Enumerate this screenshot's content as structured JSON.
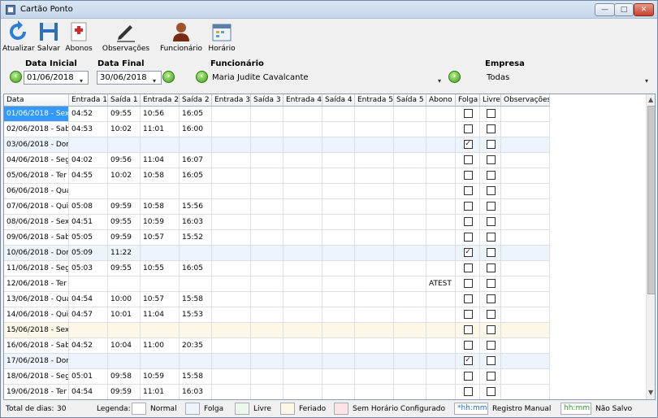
{
  "window": {
    "title": "Cartão Ponto",
    "min": "—",
    "max": "□",
    "close": "✕"
  },
  "toolbar": [
    {
      "label": "Atualizar",
      "icon": "refresh-icon"
    },
    {
      "label": "Salvar",
      "icon": "save-icon"
    },
    {
      "label": "Abonos",
      "icon": "medical-icon"
    },
    {
      "label": "Observações",
      "icon": "pen-icon"
    },
    {
      "label": "Funcionário",
      "icon": "user-icon"
    },
    {
      "label": "Horário",
      "icon": "calendar-icon"
    }
  ],
  "filters": {
    "data_inicial_label": "Data Inicial",
    "data_inicial": "01/06/2018",
    "data_final_label": "Data Final",
    "data_final": "30/06/2018",
    "funcionario_label": "Funcionário",
    "funcionario": "Maria Judite Cavalcante",
    "empresa_label": "Empresa",
    "empresa": "Todas"
  },
  "table": {
    "columns": [
      "Data",
      "Entrada 1",
      "Saída 1",
      "Entrada 2",
      "Saída 2",
      "Entrada 3",
      "Saída 3",
      "Entrada 4",
      "Saída 4",
      "Entrada 5",
      "Saída 5",
      "Abono",
      "Folga",
      "Livre",
      "Observações"
    ],
    "rows": [
      {
        "data": "01/06/2018 - Sex",
        "e1": "04:52",
        "s1": "09:55",
        "e2": "10:56",
        "s2": "16:05",
        "abono": "",
        "folga": false,
        "livre": false,
        "kind": "sel"
      },
      {
        "data": "02/06/2018 - Sab",
        "e1": "04:53",
        "s1": "10:02",
        "e2": "11:01",
        "s2": "16:00",
        "abono": "",
        "folga": false,
        "livre": false,
        "kind": "normal"
      },
      {
        "data": "03/06/2018 - Dom",
        "e1": "",
        "s1": "",
        "e2": "",
        "s2": "",
        "abono": "",
        "folga": true,
        "livre": false,
        "kind": "folga"
      },
      {
        "data": "04/06/2018 - Seg",
        "e1": "04:02",
        "s1": "09:56",
        "e2": "11:04",
        "s2": "16:07",
        "abono": "",
        "folga": false,
        "livre": false,
        "kind": "normal"
      },
      {
        "data": "05/06/2018 - Ter",
        "e1": "04:55",
        "s1": "10:02",
        "e2": "10:58",
        "s2": "16:05",
        "abono": "",
        "folga": false,
        "livre": false,
        "kind": "normal"
      },
      {
        "data": "06/06/2018 - Qua",
        "e1": "",
        "s1": "",
        "e2": "",
        "s2": "",
        "abono": "",
        "folga": false,
        "livre": false,
        "kind": "normal"
      },
      {
        "data": "07/06/2018 - Qui",
        "e1": "05:08",
        "s1": "09:59",
        "e2": "10:58",
        "s2": "15:56",
        "abono": "",
        "folga": false,
        "livre": false,
        "kind": "normal"
      },
      {
        "data": "08/06/2018 - Sex",
        "e1": "04:51",
        "s1": "09:55",
        "e2": "10:59",
        "s2": "16:03",
        "abono": "",
        "folga": false,
        "livre": false,
        "kind": "normal"
      },
      {
        "data": "09/06/2018 - Sab",
        "e1": "05:05",
        "s1": "09:59",
        "e2": "10:57",
        "s2": "15:52",
        "abono": "",
        "folga": false,
        "livre": false,
        "kind": "normal"
      },
      {
        "data": "10/06/2018 - Dom",
        "e1": "05:09",
        "s1": "11:22",
        "e2": "",
        "s2": "",
        "abono": "",
        "folga": true,
        "livre": false,
        "kind": "folga"
      },
      {
        "data": "11/06/2018 - Seg",
        "e1": "05:03",
        "s1": "09:55",
        "e2": "10:55",
        "s2": "16:05",
        "abono": "",
        "folga": false,
        "livre": false,
        "kind": "normal"
      },
      {
        "data": "12/06/2018 - Ter",
        "e1": "",
        "s1": "",
        "e2": "",
        "s2": "",
        "abono": "ATEST",
        "folga": false,
        "livre": false,
        "kind": "normal"
      },
      {
        "data": "13/06/2018 - Qua",
        "e1": "04:54",
        "s1": "10:00",
        "e2": "10:57",
        "s2": "15:58",
        "abono": "",
        "folga": false,
        "livre": false,
        "kind": "normal"
      },
      {
        "data": "14/06/2018 - Qui",
        "e1": "04:57",
        "s1": "10:01",
        "e2": "11:04",
        "s2": "15:53",
        "abono": "",
        "folga": false,
        "livre": false,
        "kind": "normal"
      },
      {
        "data": "15/06/2018 - Sex",
        "e1": "",
        "s1": "",
        "e2": "",
        "s2": "",
        "abono": "",
        "folga": false,
        "livre": false,
        "kind": "feriado"
      },
      {
        "data": "16/06/2018 - Sab",
        "e1": "04:52",
        "s1": "10:04",
        "e2": "11:00",
        "s2": "20:35",
        "abono": "",
        "folga": false,
        "livre": false,
        "kind": "normal"
      },
      {
        "data": "17/06/2018 - Dom",
        "e1": "",
        "s1": "",
        "e2": "",
        "s2": "",
        "abono": "",
        "folga": true,
        "livre": false,
        "kind": "folga"
      },
      {
        "data": "18/06/2018 - Seg",
        "e1": "05:01",
        "s1": "09:58",
        "e2": "10:59",
        "s2": "15:58",
        "abono": "",
        "folga": false,
        "livre": false,
        "kind": "normal"
      },
      {
        "data": "19/06/2018 - Ter",
        "e1": "04:54",
        "s1": "09:59",
        "e2": "11:01",
        "s2": "16:03",
        "abono": "",
        "folga": false,
        "livre": false,
        "kind": "normal"
      }
    ]
  },
  "footer": {
    "total_label": "Total de dias:",
    "total_value": "30",
    "legenda": "Legenda:",
    "normal": "Normal",
    "folga": "Folga",
    "livre": "Livre",
    "feriado": "Feriado",
    "sem_horario": "Sem Horário Configurado",
    "manual_sample": "*hh:mm",
    "manual_label": "Registro Manual",
    "nao_salvo_sample": "hh:mm",
    "nao_salvo_label": "Não Salvo"
  },
  "colors": {
    "selected": "#3399ff",
    "folga": "#eef4fb",
    "livre": "#ecf8ec",
    "feriado": "#fdf7e8",
    "sem_horario": "#fde4e4",
    "manual": "#1e6ed8",
    "nao_salvo": "#2e9a2e"
  }
}
